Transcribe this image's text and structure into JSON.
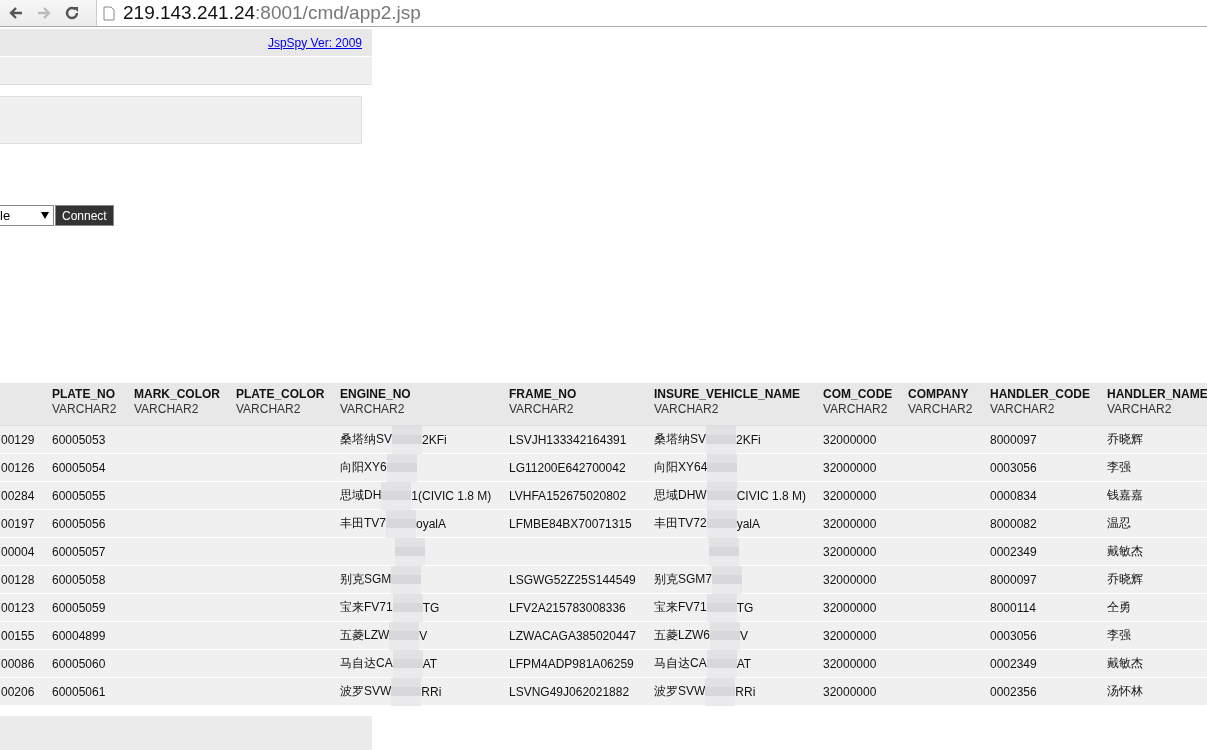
{
  "browser": {
    "url_host": "219.143.241.24",
    "url_rest": ":8001/cmd/app2.jsp"
  },
  "header_link": "JspSpy Ver: 2009",
  "connect_form": {
    "select_value": "le",
    "button": "Connect"
  },
  "table": {
    "columns": [
      {
        "name": "PLATE_NO",
        "type": "VARCHAR2"
      },
      {
        "name": "MARK_COLOR",
        "type": "VARCHAR2"
      },
      {
        "name": "PLATE_COLOR",
        "type": "VARCHAR2"
      },
      {
        "name": "ENGINE_NO",
        "type": "VARCHAR2"
      },
      {
        "name": "FRAME_NO",
        "type": "VARCHAR2"
      },
      {
        "name": "INSURE_VEHICLE_NAME",
        "type": "VARCHAR2"
      },
      {
        "name": "COM_CODE",
        "type": "VARCHAR2"
      },
      {
        "name": "COMPANY",
        "type": "VARCHAR2"
      },
      {
        "name": "HANDLER_CODE",
        "type": "VARCHAR2"
      },
      {
        "name": "HANDLER_NAME",
        "type": "VARCHAR2"
      }
    ],
    "rows": [
      {
        "column_1": "00129",
        "plate_no": "60005053",
        "engine_no": {
          "before": "桑塔纳SV",
          "after": "2KFi"
        },
        "frame_no": "LSVJH133342164391",
        "insure_vehicle_name": {
          "before": "桑塔纳SV",
          "after": "2KFi"
        },
        "com_code": "32000000",
        "handler_code": "8000097",
        "handler_name": "乔晓辉"
      },
      {
        "column_1": "00126",
        "plate_no": "60005054",
        "engine_no": {
          "before": "向阳XY6"
        },
        "frame_no": "LG11200E642700042",
        "insure_vehicle_name": {
          "before": "向阳XY64"
        },
        "com_code": "32000000",
        "handler_code": "0003056",
        "handler_name": "李强"
      },
      {
        "column_1": "00284",
        "plate_no": "60005055",
        "engine_no": {
          "before": "思域DH",
          "after": "1(CIVIC 1.8 M)"
        },
        "frame_no": "LVHFA152675020802",
        "insure_vehicle_name": {
          "before": "思域DHW",
          "after": "CIVIC 1.8 M)"
        },
        "com_code": "32000000",
        "handler_code": "0000834",
        "handler_name": "钱嘉嘉"
      },
      {
        "column_1": "00197",
        "plate_no": "60005056",
        "engine_no": {
          "before": "丰田TV7",
          "after": "oyalA"
        },
        "frame_no": "LFMBE84BX70071315",
        "insure_vehicle_name": {
          "before": "丰田TV72",
          "after": "yalA"
        },
        "com_code": "32000000",
        "handler_code": "8000082",
        "handler_name": "温忍"
      },
      {
        "column_1": "00004",
        "plate_no": "60005057",
        "engine_no": {},
        "insure_vehicle_name": {},
        "com_code": "32000000",
        "handler_code": "0002349",
        "handler_name": "戴敏杰"
      },
      {
        "column_1": "00128",
        "plate_no": "60005058",
        "engine_no": {
          "before": "别克SGM"
        },
        "frame_no": "LSGWG52Z25S144549",
        "insure_vehicle_name": {
          "before": "别克SGM7"
        },
        "com_code": "32000000",
        "handler_code": "8000097",
        "handler_name": "乔晓辉"
      },
      {
        "column_1": "00123",
        "plate_no": "60005059",
        "engine_no": {
          "before": "宝来FV71",
          "after": "TG"
        },
        "frame_no": "LFV2A215783008336",
        "insure_vehicle_name": {
          "before": "宝来FV71",
          "after": "TG"
        },
        "com_code": "32000000",
        "handler_code": "8000114",
        "handler_name": "仝勇"
      },
      {
        "column_1": "00155",
        "plate_no": "60004899",
        "engine_no": {
          "before": "五菱LZW",
          "after": "V"
        },
        "frame_no": "LZWACAGA385020447",
        "insure_vehicle_name": {
          "before": "五菱LZW6",
          "after": "V"
        },
        "com_code": "32000000",
        "handler_code": "0003056",
        "handler_name": "李强"
      },
      {
        "column_1": "00086",
        "plate_no": "60005060",
        "engine_no": {
          "before": "马自达CA",
          "after": "AT"
        },
        "frame_no": "LFPM4ADP981A06259",
        "insure_vehicle_name": {
          "before": "马自达CA",
          "after": "AT"
        },
        "com_code": "32000000",
        "handler_code": "0002349",
        "handler_name": "戴敏杰"
      },
      {
        "column_1": "00206",
        "plate_no": "60005061",
        "engine_no": {
          "before": "波罗SVW",
          "after": "RRi"
        },
        "frame_no": "LSVNG49J062021882",
        "insure_vehicle_name": {
          "before": "波罗SVW",
          "after": "RRi"
        },
        "com_code": "32000000",
        "handler_code": "0002356",
        "handler_name": "汤怀林"
      }
    ]
  }
}
